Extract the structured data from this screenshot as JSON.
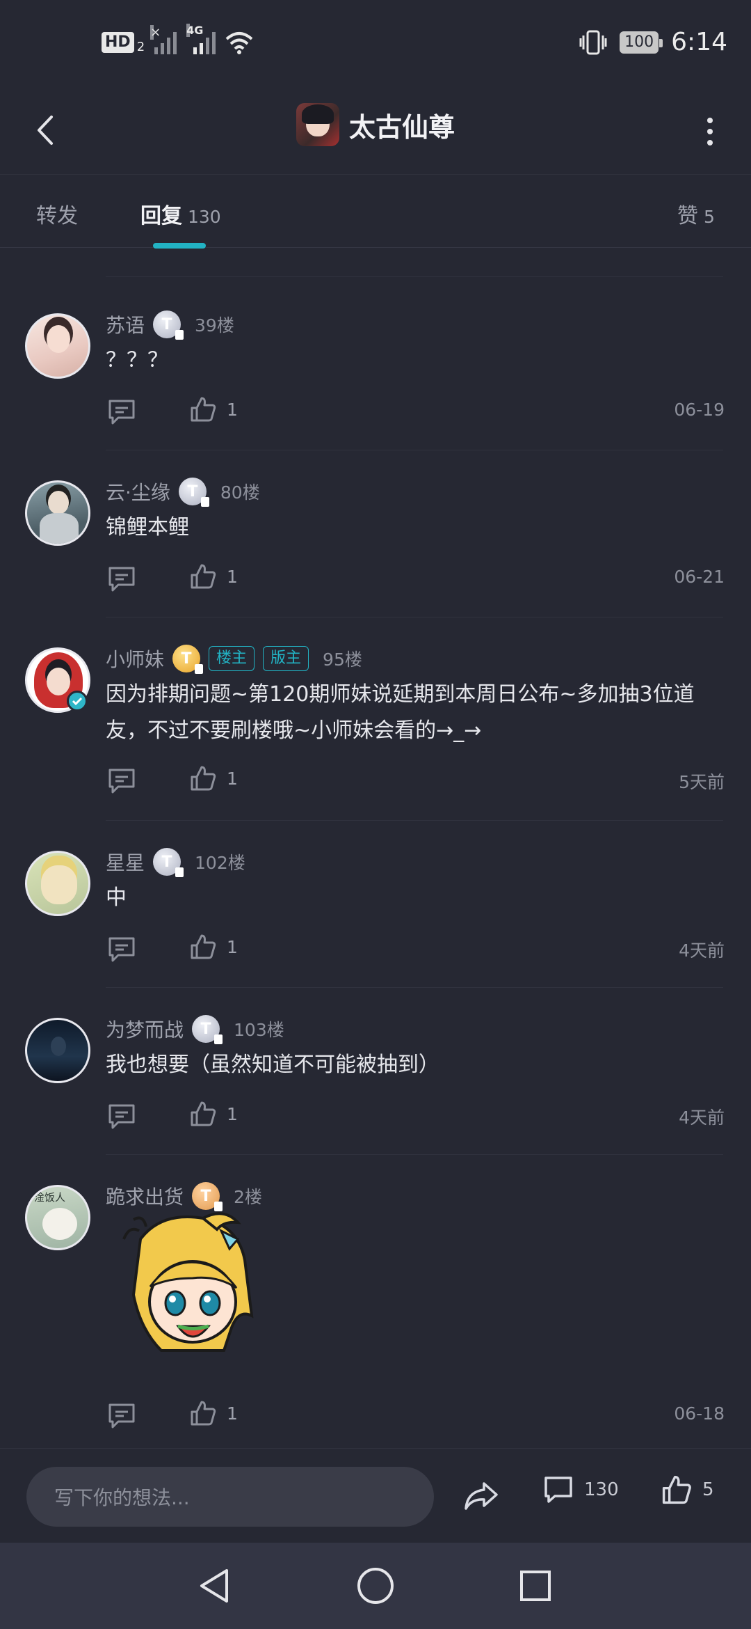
{
  "status_bar": {
    "hd_label": "HD",
    "hd_sub": "2",
    "net_label": "4G",
    "battery": "100",
    "time": "6:14"
  },
  "header": {
    "title": "太古仙尊"
  },
  "tabs": [
    {
      "label": "转发",
      "count": ""
    },
    {
      "label": "回复",
      "count": "130"
    },
    {
      "label": "赞",
      "count": "5"
    }
  ],
  "posts": [
    {
      "username": "苏语",
      "floor": "39楼",
      "content": "？？？",
      "likes": "1",
      "time": "06-19",
      "tags": []
    },
    {
      "username": "云·尘缘",
      "floor": "80楼",
      "content": "锦鲤本鲤",
      "likes": "1",
      "time": "06-21",
      "tags": []
    },
    {
      "username": "小师妹",
      "floor": "95楼",
      "content": "因为排期问题~第120期师妹说延期到本周日公布~多加抽3位道友，不过不要刷楼哦~小师妹会看的→_→",
      "likes": "1",
      "time": "5天前",
      "tags": [
        "楼主",
        "版主"
      ]
    },
    {
      "username": "星星",
      "floor": "102楼",
      "content": "中",
      "likes": "1",
      "time": "4天前",
      "tags": []
    },
    {
      "username": "为梦而战",
      "floor": "103楼",
      "content": "我也想要（虽然知道不可能被抽到）",
      "likes": "1",
      "time": "4天前",
      "tags": []
    },
    {
      "username": "跪求出货",
      "floor": "2楼",
      "content": "",
      "likes": "1",
      "time": "06-18",
      "tags": [],
      "avatar_text": "淦饭人"
    }
  ],
  "bottom_bar": {
    "input_placeholder": "写下你的想法...",
    "comment_count": "130",
    "like_count": "5"
  },
  "colors": {
    "background": "#262833",
    "accent": "#22b3c4",
    "navbar": "#333544"
  }
}
